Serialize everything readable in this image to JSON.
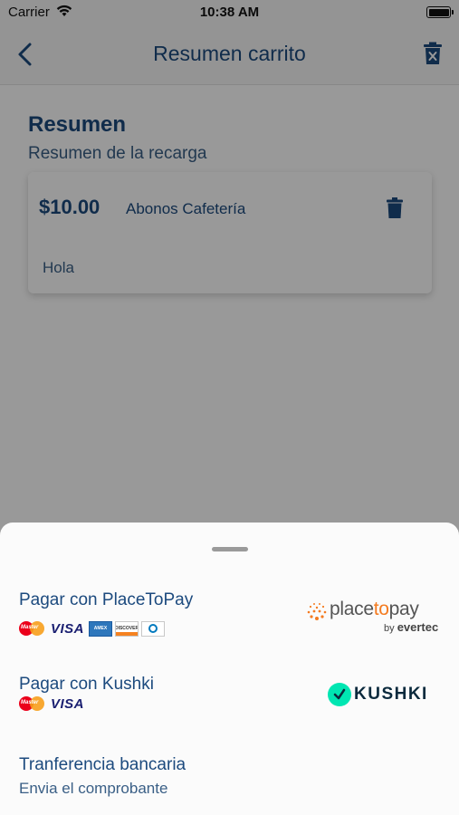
{
  "status_bar": {
    "carrier": "Carrier",
    "time": "10:38 AM"
  },
  "navbar": {
    "title": "Resumen carrito"
  },
  "summary": {
    "title": "Resumen",
    "subtitle": "Resumen de la recarga"
  },
  "cart_item": {
    "amount": "$10.00",
    "concept": "Abonos Cafetería",
    "note": "Hola"
  },
  "payment_sheet": {
    "options": [
      {
        "title": "Pagar con PlaceToPay",
        "brands": [
          "MasterCard",
          "VISA",
          "American Express",
          "DISCOVER",
          "Diners Club"
        ],
        "logo": {
          "word_a": "place",
          "word_b": "to",
          "word_c": "pay",
          "by": "by",
          "brand": "evertec"
        }
      },
      {
        "title": "Pagar con Kushki",
        "brands": [
          "MasterCard",
          "VISA"
        ],
        "logo": {
          "word": "KUSHKI"
        }
      },
      {
        "title": "Tranferencia bancaria",
        "subtitle": "Envia el comprobante"
      }
    ]
  },
  "colors": {
    "primary": "#1c4a7e",
    "secondary_text": "#3a5f86",
    "overlay": "rgba(0,0,0,0.40)",
    "placetopay_orange": "#f47b20",
    "kushki_green": "#00e6b2"
  },
  "icons": [
    "wifi-icon",
    "battery-icon",
    "back-chevron-icon",
    "delete-cart-icon",
    "trash-icon",
    "mastercard-icon",
    "visa-icon",
    "amex-icon",
    "discover-icon",
    "diners-icon",
    "placetopay-logo",
    "kushki-logo"
  ]
}
